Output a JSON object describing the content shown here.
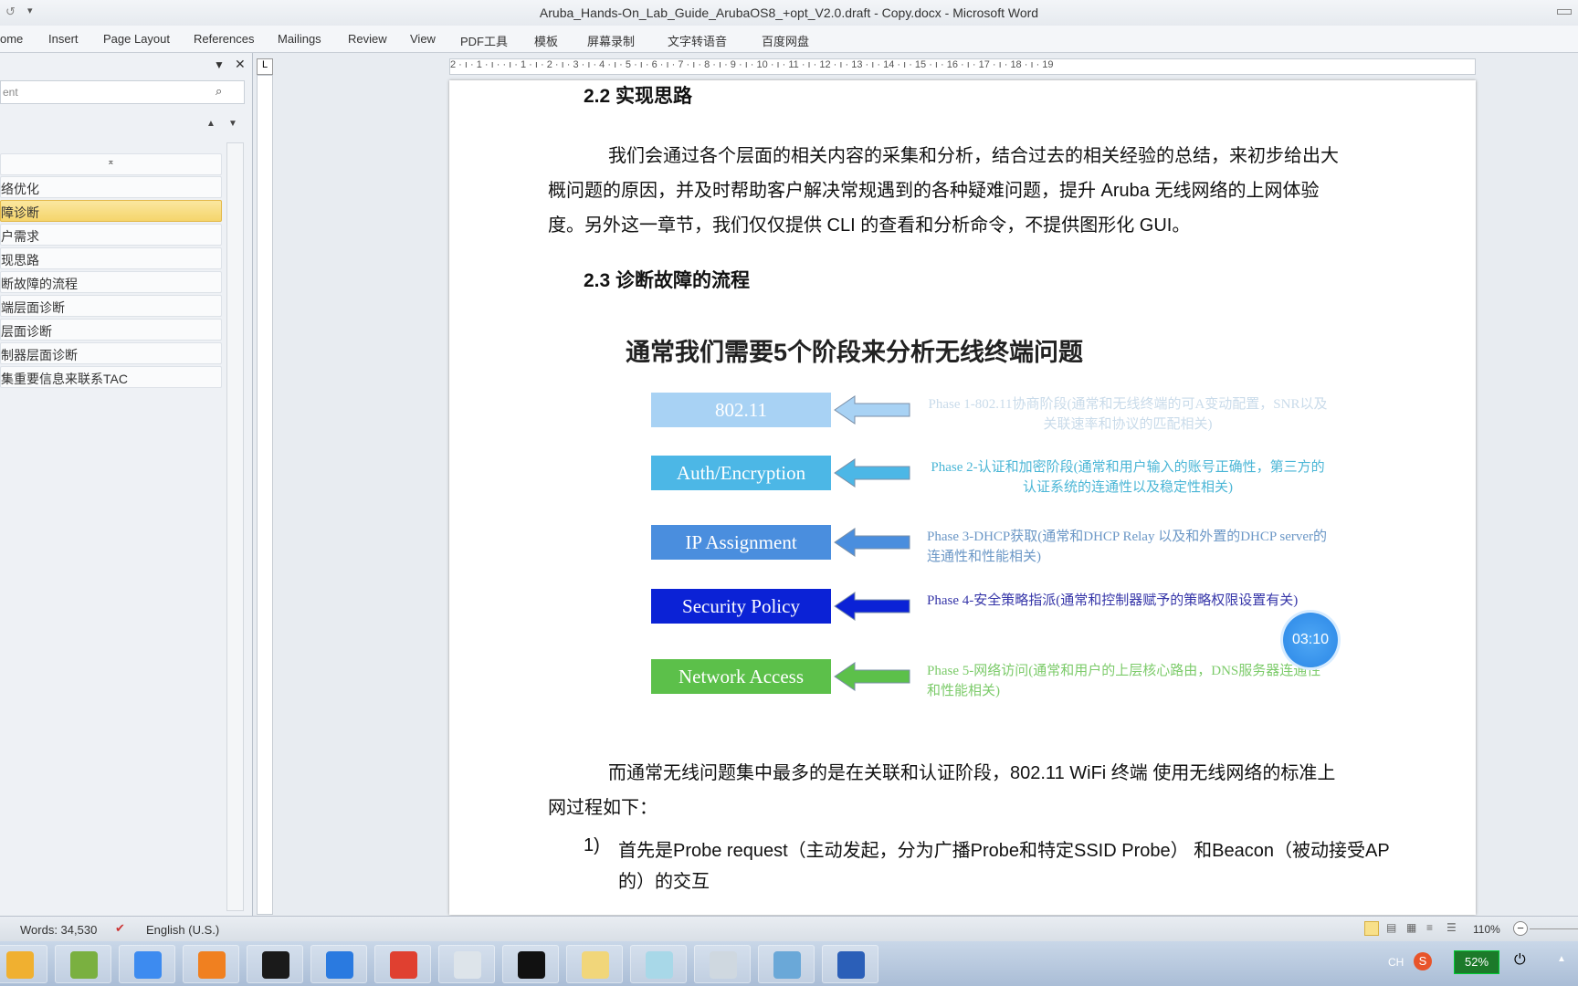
{
  "window": {
    "title": "Aruba_Hands-On_Lab_Guide_ArubaOS8_+opt_V2.0.draft - Copy.docx - Microsoft Word"
  },
  "ribbon": {
    "tabs": [
      "ome",
      "Insert",
      "Page Layout",
      "References",
      "Mailings",
      "Review",
      "View",
      "PDF工具",
      "模板",
      "屏幕录制",
      "文字转语音",
      "百度网盘"
    ]
  },
  "nav": {
    "search_placeholder": "ent",
    "items": [
      "络优化",
      "障诊断",
      "户需求",
      "现思路",
      "断故障的流程",
      "端层面诊断",
      "层面诊断",
      "制器层面诊断",
      "集重要信息来联系TAC"
    ],
    "selected": 1
  },
  "ruler": {
    "labels": "2 · ı · 1 · ı ·  · ı · 1 · ı · 2 · ı · 3 · ı · 4 · ı · 5 · ı · 6 · ı · 7 · ı · 8 · ı · 9 · ı · 10 · ı · 11 · ı · 12 · ı · 13 · ı · 14 · ı · 15 · ı · 16 · ı · 17 · ı · 18 · ı · 19"
  },
  "doc": {
    "h22": "2.2   实现思路",
    "p1": [
      "我们会通过各个层面的相关内容的采集和分析，结合过去的相关经验的总结，来初步给出大",
      "概问题的原因，并及时帮助客户解决常规遇到的各种疑难问题，提升 Aruba 无线网络的上网体验",
      "度。另外这一章节，我们仅仅提供 CLI 的查看和分析命令，不提供图形化 GUI。"
    ],
    "h23": "2.3   诊断故障的流程",
    "diagram": {
      "title": "通常我们需要5个阶段来分析无线终端问题",
      "phases": [
        {
          "label": "802.11",
          "desc": "Phase 1-802.11协商阶段(通常和无线终端的可A变动配置，SNR以及关联速率和协议的匹配相关)",
          "color": "#a8d2f4",
          "text_color": "#c9dbea"
        },
        {
          "label": "Auth/Encryption",
          "desc": "Phase 2-认证和加密阶段(通常和用户输入的账号正确性，第三方的认证系统的连通性以及稳定性相关)",
          "color": "#4cb7e6",
          "text_color": "#4bb6d6"
        },
        {
          "label": "IP Assignment",
          "desc": "Phase 3-DHCP获取(通常和DHCP Relay 以及和外置的DHCP server的连通性和性能相关)",
          "color": "#4a8ede",
          "text_color": "#6b97c6"
        },
        {
          "label": "Security Policy",
          "desc": "Phase 4-安全策略指派(通常和控制器赋予的策略权限设置有关)",
          "color": "#0b22d6",
          "text_color": "#3535a8"
        },
        {
          "label": "Network Access",
          "desc": "Phase 5-网络访问(通常和用户的上层核心路由，DNS服务器连通性和性能相关)",
          "color": "#5cc04a",
          "text_color": "#7ccb6a"
        }
      ]
    },
    "p2": [
      "而通常无线问题集中最多的是在关联和认证阶段，802.11 WiFi 终端 使用无线网络的标准上",
      "网过程如下："
    ],
    "item1_num": "1)",
    "item1": [
      "首先是Probe request（主动发起，分为广播Probe和特定SSID Probe） 和Beacon（被动接受AP",
      "的）的交互"
    ]
  },
  "timer": "03:10",
  "status": {
    "words": "Words: 34,530",
    "language": "English (U.S.)",
    "zoom": "110%"
  },
  "tray": {
    "ime": "CH",
    "battery": "52%"
  },
  "taskbar": {
    "icons": [
      "outlook-icon",
      "vmware-icon",
      "zoom-icon",
      "hashtag-icon",
      "s-app-icon",
      "m-app-icon",
      "chrome-icon",
      "printer-icon",
      "terminal-icon",
      "folder-icon",
      "notes-icon",
      "calculator-icon",
      "remote-desktop-icon",
      "word-icon"
    ]
  }
}
